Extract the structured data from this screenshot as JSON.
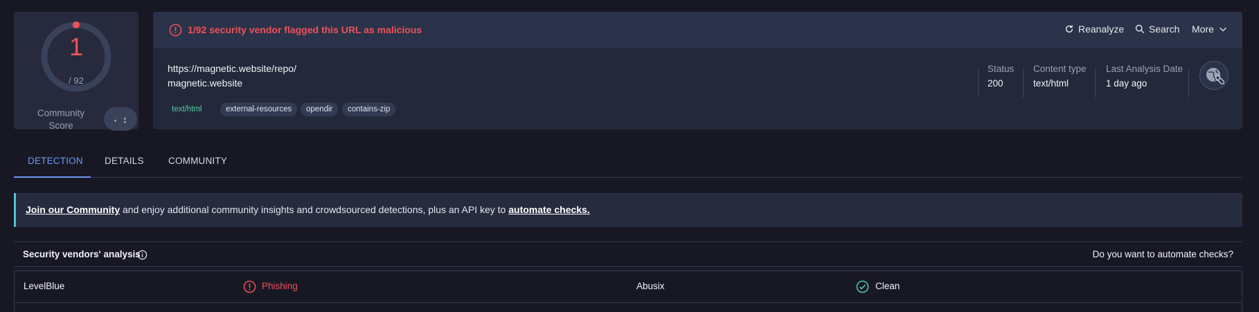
{
  "score": {
    "detections": "1",
    "total": "/ 92",
    "community_label": "Community Score"
  },
  "alert": {
    "text": "1/92 security vendor flagged this URL as malicious"
  },
  "actions": {
    "reanalyze": "Reanalyze",
    "search": "Search",
    "more": "More"
  },
  "target": {
    "url": "https://magnetic.website/repo/",
    "domain": "magnetic.website"
  },
  "tags": [
    "text/html",
    "external-resources",
    "opendir",
    "contains-zip"
  ],
  "meta": {
    "status_label": "Status",
    "status_value": "200",
    "content_type_label": "Content type",
    "content_type_value": "text/html",
    "last_analysis_label": "Last Analysis Date",
    "last_analysis_value": "1 day ago"
  },
  "tabs": [
    {
      "label": "DETECTION",
      "active": true
    },
    {
      "label": "DETAILS",
      "active": false
    },
    {
      "label": "COMMUNITY",
      "active": false
    }
  ],
  "banner": {
    "link1": "Join our Community",
    "middle": " and enjoy additional community insights and crowdsourced detections, plus an API key to ",
    "link2": "automate checks."
  },
  "vendors": {
    "title": "Security vendors' analysis",
    "automate_question": "Do you want to automate checks?",
    "rows": [
      {
        "vendor_a": "LevelBlue",
        "result_a": "Phishing",
        "status_a": "malicious",
        "vendor_b": "Abusix",
        "result_b": "Clean",
        "status_b": "clean"
      }
    ]
  },
  "colors": {
    "malicious": "#ef5058",
    "clean": "#57c9a4",
    "accent": "#6e9cf5",
    "banner_accent": "#4cc4d0"
  }
}
